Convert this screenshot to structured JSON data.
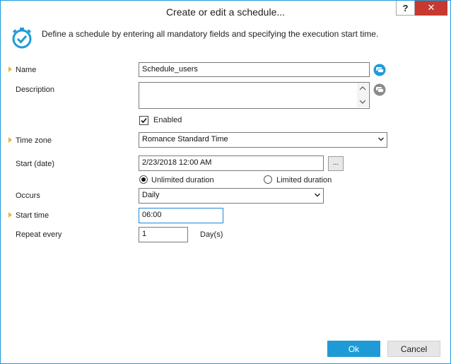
{
  "window": {
    "title": "Create or edit a schedule...",
    "help_label": "?",
    "close_label": "✕"
  },
  "header": {
    "description": "Define a schedule by entering all mandatory fields and specifying the execution start time."
  },
  "form": {
    "name": {
      "label": "Name",
      "value": "Schedule_users"
    },
    "description": {
      "label": "Description",
      "value": ""
    },
    "enabled": {
      "label": "Enabled",
      "checked": true
    },
    "time_zone": {
      "label": "Time zone",
      "value": "Romance Standard Time"
    },
    "start_date": {
      "label": "Start (date)",
      "value": "2/23/2018 12:00 AM",
      "picker_label": "..."
    },
    "duration": {
      "unlimited_label": "Unlimited duration",
      "limited_label": "Limited duration",
      "selected": "unlimited"
    },
    "occurs": {
      "label": "Occurs",
      "value": "Daily"
    },
    "start_time": {
      "label": "Start time",
      "value": "06:00"
    },
    "repeat_every": {
      "label": "Repeat every",
      "value": "1",
      "unit": "Day(s)"
    }
  },
  "buttons": {
    "ok": "Ok",
    "cancel": "Cancel"
  },
  "colors": {
    "accent": "#1e9bd7",
    "required_marker": "#f2b134",
    "close_button": "#c7392e"
  },
  "icons": {
    "header": "clock-check-icon",
    "name_action": "comment-icon",
    "description_action": "comment-icon",
    "select_arrow": "chevron-down-icon"
  }
}
